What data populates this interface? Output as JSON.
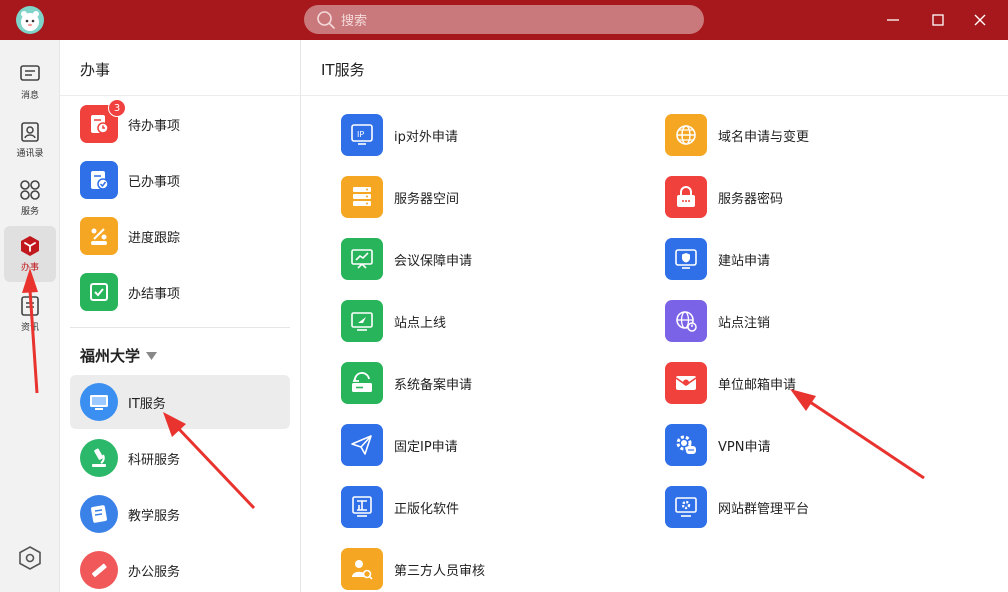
{
  "titlebar": {
    "search_placeholder": "搜索"
  },
  "rail": [
    {
      "label": "消息"
    },
    {
      "label": "通讯录"
    },
    {
      "label": "服务"
    },
    {
      "label": "办事"
    },
    {
      "label": "资讯"
    }
  ],
  "middle": {
    "title": "办事",
    "todo": [
      {
        "label": "待办事项",
        "badge": "3"
      },
      {
        "label": "已办事项"
      },
      {
        "label": "进度跟踪"
      },
      {
        "label": "办结事项"
      }
    ],
    "org": "福州大学",
    "services": [
      {
        "label": "IT服务"
      },
      {
        "label": "科研服务"
      },
      {
        "label": "教学服务"
      },
      {
        "label": "办公服务"
      }
    ]
  },
  "right": {
    "title": "IT服务",
    "apps_left": [
      {
        "label": "ip对外申请"
      },
      {
        "label": "服务器空间"
      },
      {
        "label": "会议保障申请"
      },
      {
        "label": "站点上线"
      },
      {
        "label": "系统备案申请"
      },
      {
        "label": "固定IP申请"
      },
      {
        "label": "正版化软件"
      },
      {
        "label": "第三方人员审核"
      }
    ],
    "apps_right": [
      {
        "label": "域名申请与变更"
      },
      {
        "label": "服务器密码"
      },
      {
        "label": "建站申请"
      },
      {
        "label": "站点注销"
      },
      {
        "label": "单位邮箱申请"
      },
      {
        "label": "VPN申请"
      },
      {
        "label": "网站群管理平台"
      }
    ]
  },
  "colors": {
    "titlebar": "#a6181c",
    "accent_red": "#c0181d",
    "annotation_arrow": "#e8332e"
  }
}
